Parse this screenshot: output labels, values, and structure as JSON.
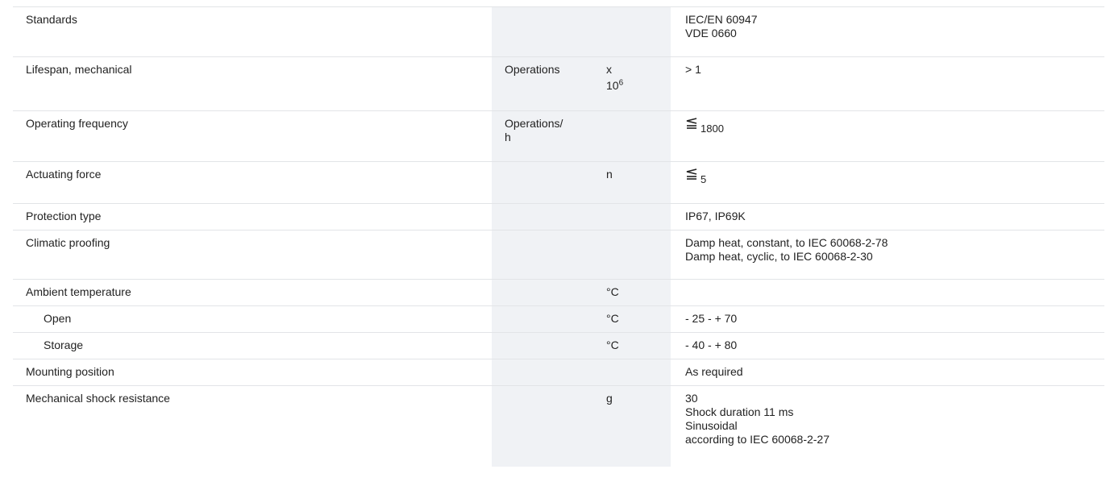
{
  "rows": [
    {
      "name": "Standards",
      "unit1": "",
      "unit2": "",
      "values": [
        "IEC/EN 60947",
        "VDE 0660"
      ]
    },
    {
      "name": "Lifespan, mechanical",
      "unit1": "Operations",
      "unit2_base": "x",
      "unit2_line2": "10",
      "unit2_sup": "6",
      "values": [
        "> 1"
      ]
    },
    {
      "name": "Operating frequency",
      "unit1_line1": "Operations/",
      "unit1_line2": "h",
      "unit2": "",
      "value": "1800",
      "value_icon": "less-than-or-equal-icon"
    },
    {
      "name": "Actuating force",
      "unit1": "",
      "unit2": "n",
      "value": "5",
      "value_icon": "less-than-or-equal-icon"
    },
    {
      "name": "Protection type",
      "unit1": "",
      "unit2": "",
      "values": [
        "IP67, IP69K"
      ]
    },
    {
      "name": "Climatic proofing",
      "unit1": "",
      "unit2": "",
      "values": [
        "Damp heat, constant, to IEC 60068-2-78",
        "Damp heat, cyclic, to IEC 60068-2-30"
      ]
    },
    {
      "name": "Ambient temperature",
      "unit1": "",
      "unit2": "°C",
      "values": [
        ""
      ]
    },
    {
      "name": "Open",
      "unit1": "",
      "unit2": "°C",
      "values": [
        "- 25 - + 70"
      ]
    },
    {
      "name": "Storage",
      "unit1": "",
      "unit2": "°C",
      "values": [
        "- 40 - + 80"
      ]
    },
    {
      "name": "Mounting position",
      "unit1": "",
      "unit2": "",
      "values": [
        "As required"
      ]
    },
    {
      "name": "Mechanical shock resistance",
      "unit1": "",
      "unit2": "g",
      "values": [
        "30",
        "Shock duration 11 ms",
        "Sinusoidal",
        "according to IEC 60068-2-27"
      ]
    }
  ]
}
